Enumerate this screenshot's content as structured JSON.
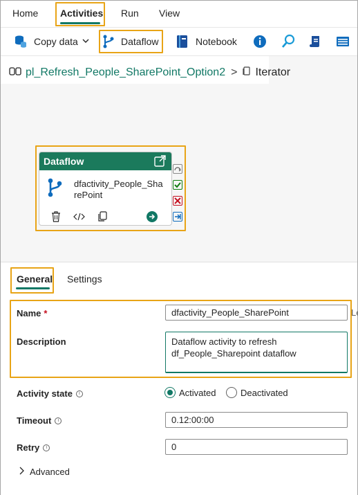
{
  "menu": {
    "tabs": [
      {
        "label": "Home"
      },
      {
        "label": "Activities"
      },
      {
        "label": "Run"
      },
      {
        "label": "View"
      }
    ]
  },
  "toolbar": {
    "copy_data_label": "Copy data",
    "dataflow_label": "Dataflow",
    "notebook_label": "Notebook",
    "icons": [
      "database-icon",
      "dataflow-icon",
      "notebook-icon",
      "info-icon",
      "lookup-icon",
      "script-icon",
      "list-icon"
    ]
  },
  "breadcrumb": {
    "pipeline": "pl_Refresh_People_SharePoint_Option2",
    "separator": ">",
    "current": "Iterator"
  },
  "activity_card": {
    "title": "Dataflow",
    "name": "dfactivity_People_SharePoint"
  },
  "panel": {
    "tabs": [
      {
        "label": "General"
      },
      {
        "label": "Settings"
      }
    ],
    "name_label": "Name",
    "required_mark": "*",
    "name_value": "dfactivity_People_SharePoint",
    "description_label": "Description",
    "description_value": "Dataflow activity to refresh df_People_Sharepoint dataflow",
    "activity_state_label": "Activity state",
    "activated_label": "Activated",
    "deactivated_label": "Deactivated",
    "timeout_label": "Timeout",
    "timeout_value": "0.12:00:00",
    "retry_label": "Retry",
    "retry_value": "0",
    "advanced_label": "Advanced",
    "truncated_text": "Le"
  },
  "colors": {
    "accent": "#117865",
    "card_header": "#1b7a5c",
    "highlight": "#e8a416"
  }
}
